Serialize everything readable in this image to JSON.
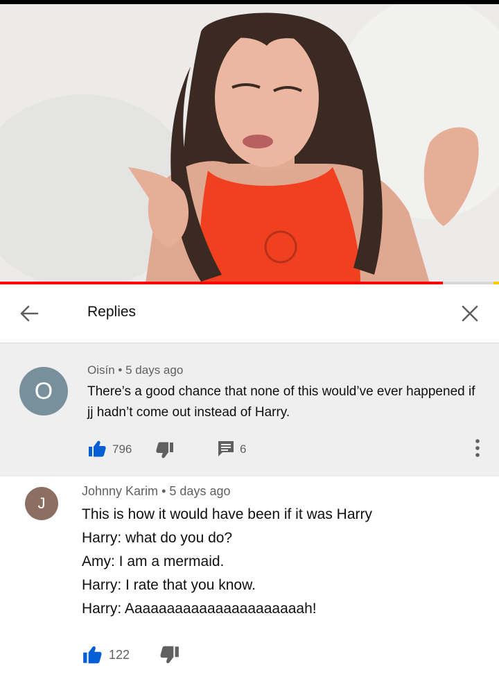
{
  "video": {
    "progress": 0.887
  },
  "header": {
    "title": "Replies"
  },
  "parent_comment": {
    "avatar_letter": "O",
    "author": "Oisín",
    "separator": "•",
    "time": "5 days ago",
    "text": "There’s a good chance that none of this would’ve ever happened if jj hadn’t come out instead of Harry.",
    "likes": "796",
    "replies": "6"
  },
  "reply_comment": {
    "avatar_letter": "J",
    "author": "Johnny Karim",
    "separator": "•",
    "time": "5 days ago",
    "lines": [
      "This is how it would have been if it was Harry",
      "Harry: what do you do?",
      "Amy: I am a mermaid.",
      "Harry: I rate that you know.",
      "Harry: Aaaaaaaaaaaaaaaaaaaaaah!"
    ],
    "likes": "122"
  },
  "colors": {
    "like_blue": "#065fd4",
    "progress_red": "#ff0000",
    "avatar_o": "#78909c",
    "avatar_j": "#8d6e63"
  },
  "icons": [
    "back-arrow-icon",
    "close-icon",
    "thumbs-up-icon",
    "thumbs-down-icon",
    "reply-icon",
    "more-vert-icon"
  ]
}
